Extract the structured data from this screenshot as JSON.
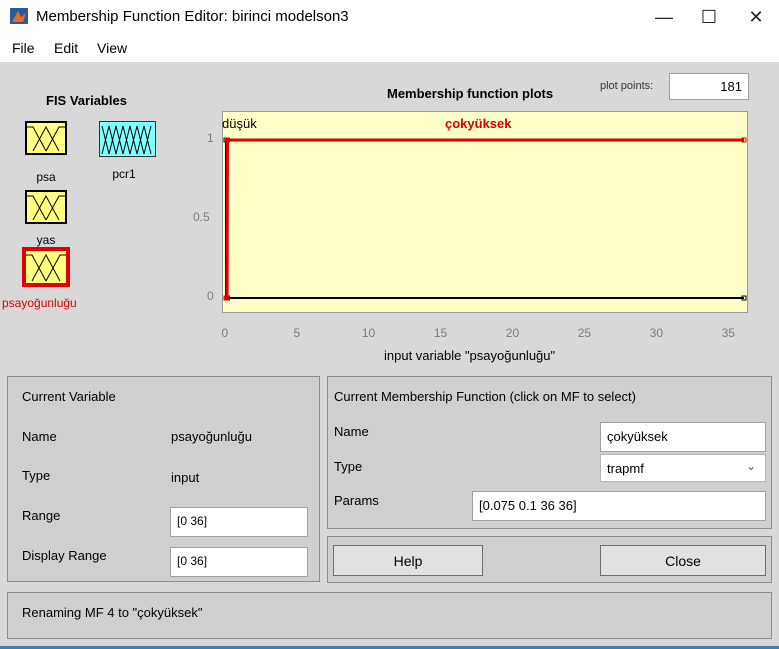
{
  "window": {
    "title": "Membership Function Editor: birinci modelson3",
    "minimize_glyph": "—",
    "maximize_glyph": "☐",
    "close_glyph": "✕"
  },
  "menu": {
    "items": [
      "File",
      "Edit",
      "View"
    ]
  },
  "fis": {
    "heading": "FIS Variables",
    "variables": [
      {
        "name": "psa",
        "kind": "input"
      },
      {
        "name": "pcr1",
        "kind": "output"
      },
      {
        "name": "yas",
        "kind": "input"
      },
      {
        "name": "psayoğunluğu",
        "kind": "input",
        "selected": true
      }
    ]
  },
  "plot": {
    "title": "Membership function plots",
    "points_label": "plot points:",
    "points_value": "181",
    "mf_labels": [
      "düşük",
      "çokyüksek"
    ],
    "xlabel": "input variable \"psayoğunluğu\"",
    "colors": {
      "selected": "#e00000",
      "other": "#000000",
      "background": "#ffffc8"
    }
  },
  "chart_data": {
    "type": "line",
    "xlim": [
      0,
      36
    ],
    "ylim": [
      0,
      1
    ],
    "xticks": [
      "0",
      "5",
      "10",
      "15",
      "20",
      "25",
      "30",
      "35"
    ],
    "yticks": [
      "0",
      "0.5",
      "1"
    ],
    "series": [
      {
        "name": "düşük",
        "x": [
          0,
          0,
          0.1,
          36
        ],
        "y": [
          0,
          1,
          0,
          0
        ],
        "color": "#000000"
      },
      {
        "name": "çokyüksek",
        "x": [
          0,
          0.075,
          0.1,
          36
        ],
        "y": [
          0,
          0,
          1,
          1
        ],
        "color": "#e00000"
      }
    ]
  },
  "current_variable": {
    "heading": "Current Variable",
    "name_label": "Name",
    "name_value": "psayoğunluğu",
    "type_label": "Type",
    "type_value": "input",
    "range_label": "Range",
    "range_value": "[0 36]",
    "display_range_label": "Display Range",
    "display_range_value": "[0 36]"
  },
  "current_mf": {
    "heading": "Current Membership Function (click on MF to select)",
    "name_label": "Name",
    "name_value": "çokyüksek",
    "type_label": "Type",
    "type_value": "trapmf",
    "params_label": "Params",
    "params_value": "[0.075 0.1 36 36]"
  },
  "buttons": {
    "help": "Help",
    "close": "Close"
  },
  "status": "Renaming MF 4 to \"çokyüksek\""
}
